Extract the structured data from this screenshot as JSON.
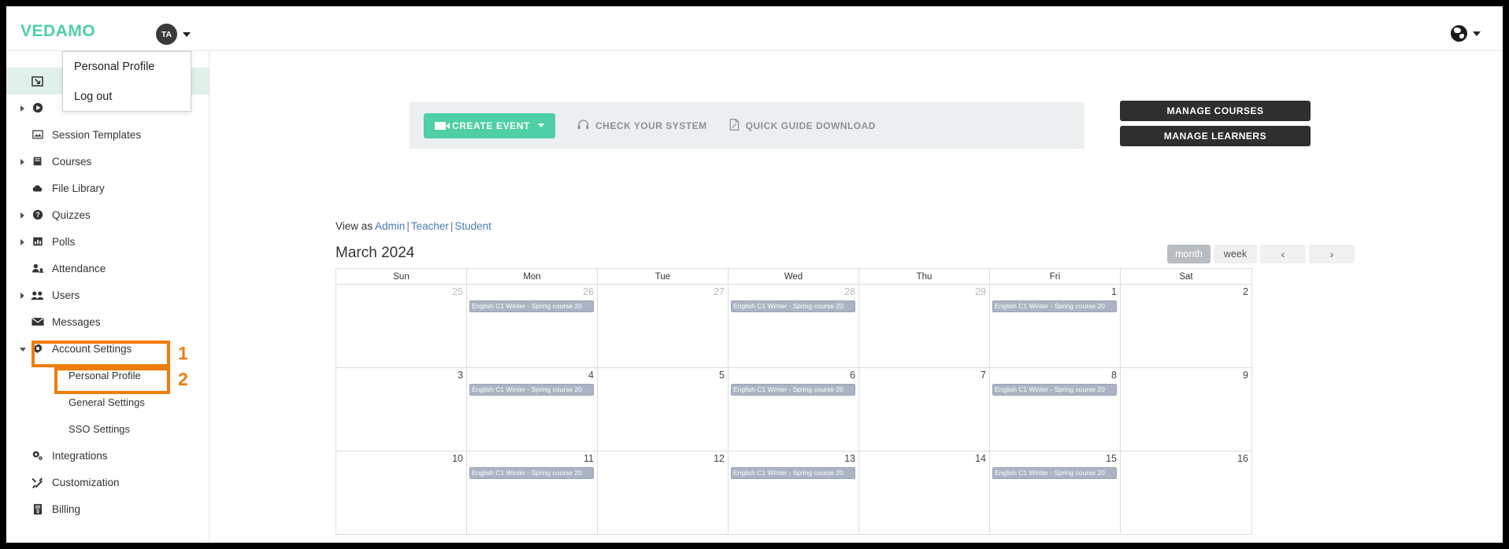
{
  "topbar": {
    "logo": "VEDAMO",
    "avatar_initials": "TA",
    "globe_icon": "globe-icon",
    "caret_icon": "chevron-down-icon"
  },
  "profile_menu": {
    "items": [
      {
        "label": "Personal Profile"
      },
      {
        "label": "Log out"
      }
    ]
  },
  "sidebar": {
    "items": [
      {
        "label": "",
        "icon": "dashboard-icon",
        "expandable": false,
        "highlight": true,
        "indent": false
      },
      {
        "label": "",
        "icon": "play-circle-icon",
        "expandable": true,
        "highlight": false,
        "indent": false
      },
      {
        "label": "Session Templates",
        "icon": "template-icon",
        "expandable": false,
        "highlight": false,
        "indent": false
      },
      {
        "label": "Courses",
        "icon": "book-icon",
        "expandable": true,
        "highlight": false,
        "indent": false
      },
      {
        "label": "File Library",
        "icon": "cloud-icon",
        "expandable": false,
        "highlight": false,
        "indent": false
      },
      {
        "label": "Quizzes",
        "icon": "question-circle-icon",
        "expandable": true,
        "highlight": false,
        "indent": false
      },
      {
        "label": "Polls",
        "icon": "bar-chart-icon",
        "expandable": true,
        "highlight": false,
        "indent": false
      },
      {
        "label": "Attendance",
        "icon": "user-check-icon",
        "expandable": false,
        "highlight": false,
        "indent": false
      },
      {
        "label": "Users",
        "icon": "users-icon",
        "expandable": true,
        "highlight": false,
        "indent": false
      },
      {
        "label": "Messages",
        "icon": "envelope-icon",
        "expandable": false,
        "highlight": false,
        "indent": false
      },
      {
        "label": "Account Settings",
        "icon": "gear-icon",
        "expandable": true,
        "expanded": true,
        "highlight": false,
        "indent": false
      }
    ],
    "account_sub_items": [
      {
        "label": "Personal Profile"
      },
      {
        "label": "General Settings"
      },
      {
        "label": "SSO Settings"
      }
    ],
    "bottom_items": [
      {
        "label": "Integrations",
        "icon": "integrations-icon"
      },
      {
        "label": "Customization",
        "icon": "tools-icon"
      },
      {
        "label": "Billing",
        "icon": "invoice-icon"
      }
    ]
  },
  "annotations": [
    {
      "number": "1",
      "target": "account-settings"
    },
    {
      "number": "2",
      "target": "personal-profile"
    }
  ],
  "action_bar": {
    "create_event": "CREATE EVENT",
    "create_event_icon": "video-camera-icon",
    "check_system": "CHECK YOUR SYSTEM",
    "check_system_icon": "headset-icon",
    "quick_guide": "QUICK GUIDE DOWNLOAD",
    "quick_guide_icon": "pdf-file-icon"
  },
  "management": {
    "manage_courses": "MANAGE COURSES",
    "manage_learners": "MANAGE LEARNERS"
  },
  "view_as": {
    "prefix": "View as",
    "admin": "Admin",
    "teacher": "Teacher",
    "student": "Student",
    "separator": "|"
  },
  "calendar": {
    "title": "March 2024",
    "view_month": "month",
    "view_week": "week",
    "prev_icon": "chevron-left-icon",
    "next_icon": "chevron-right-icon",
    "prev_label": "‹",
    "next_label": "›",
    "weekdays": [
      "Sun",
      "Mon",
      "Tue",
      "Wed",
      "Thu",
      "Fri",
      "Sat"
    ],
    "event_title": "English C1 Winter - Spring course 20",
    "weeks": [
      [
        {
          "day": "25",
          "other_month": true,
          "events": []
        },
        {
          "day": "26",
          "other_month": true,
          "events": [
            "English C1 Winter - Spring course 20"
          ]
        },
        {
          "day": "27",
          "other_month": true,
          "events": []
        },
        {
          "day": "28",
          "other_month": true,
          "events": [
            "English C1 Winter - Spring course 20"
          ]
        },
        {
          "day": "29",
          "other_month": true,
          "events": []
        },
        {
          "day": "1",
          "other_month": false,
          "events": [
            "English C1 Winter - Spring course 20"
          ]
        },
        {
          "day": "2",
          "other_month": false,
          "events": []
        }
      ],
      [
        {
          "day": "3",
          "other_month": false,
          "events": []
        },
        {
          "day": "4",
          "other_month": false,
          "events": [
            "English C1 Winter - Spring course 20"
          ]
        },
        {
          "day": "5",
          "other_month": false,
          "events": []
        },
        {
          "day": "6",
          "other_month": false,
          "events": [
            "English C1 Winter - Spring course 20"
          ]
        },
        {
          "day": "7",
          "other_month": false,
          "events": []
        },
        {
          "day": "8",
          "other_month": false,
          "events": [
            "English C1 Winter - Spring course 20"
          ]
        },
        {
          "day": "9",
          "other_month": false,
          "events": []
        }
      ],
      [
        {
          "day": "10",
          "other_month": false,
          "events": []
        },
        {
          "day": "11",
          "other_month": false,
          "events": [
            "English C1 Winter - Spring course 20"
          ]
        },
        {
          "day": "12",
          "other_month": false,
          "events": []
        },
        {
          "day": "13",
          "other_month": false,
          "events": [
            "English C1 Winter - Spring course 20"
          ]
        },
        {
          "day": "14",
          "other_month": false,
          "events": []
        },
        {
          "day": "15",
          "other_month": false,
          "events": [
            "English C1 Winter - Spring course 20"
          ]
        },
        {
          "day": "16",
          "other_month": false,
          "events": []
        }
      ]
    ]
  },
  "colors": {
    "brand_green": "#4ecfa6",
    "annotation_orange": "#f07d0a",
    "event_blue": "#aab4c4",
    "dark_button": "#2f2f2f",
    "link_blue": "#4a78b5"
  }
}
